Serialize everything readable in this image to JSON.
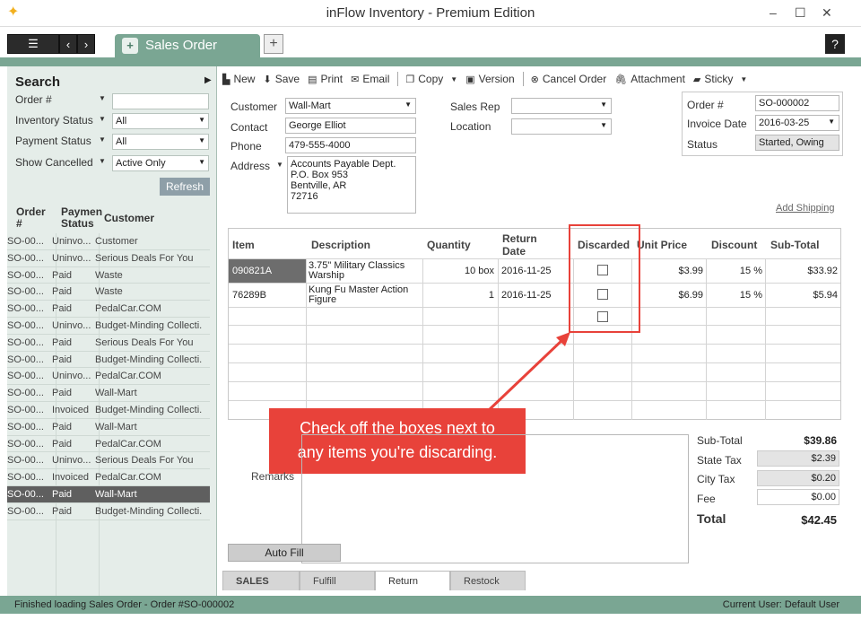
{
  "window": {
    "title": "inFlow Inventory - Premium Edition",
    "minimize": "–",
    "maximize": "☐",
    "close": "✕"
  },
  "tabbar": {
    "doc_tab": "Sales Order",
    "add_tab": "+",
    "help": "?",
    "menu_icon": "hamburger-icon",
    "back": "‹",
    "forward": "›"
  },
  "search": {
    "title": "Search",
    "fields": [
      {
        "label": "Order #",
        "value": ""
      },
      {
        "label": "Inventory Status",
        "value": "All"
      },
      {
        "label": "Payment Status",
        "value": "All"
      },
      {
        "label": "Show Cancelled",
        "value": "Active Only"
      }
    ],
    "refresh": "Refresh"
  },
  "list": {
    "headers": [
      "Order #",
      "Payment Status",
      "Customer"
    ],
    "header_order_1": "Order",
    "header_order_2": "#",
    "header_pay_1": "Paymen",
    "header_pay_2": "Status",
    "rows": [
      [
        "SO-00...",
        "Uninvo...",
        "Customer"
      ],
      [
        "SO-00...",
        "Uninvo...",
        "Serious Deals For You"
      ],
      [
        "SO-00...",
        "Paid",
        "Waste"
      ],
      [
        "SO-00...",
        "Paid",
        "Waste"
      ],
      [
        "SO-00...",
        "Paid",
        "PedalCar.COM"
      ],
      [
        "SO-00...",
        "Uninvo...",
        "Budget-Minding Collecti..."
      ],
      [
        "SO-00...",
        "Paid",
        "Serious Deals For You"
      ],
      [
        "SO-00...",
        "Paid",
        "Budget-Minding Collecti..."
      ],
      [
        "SO-00...",
        "Uninvo...",
        "PedalCar.COM"
      ],
      [
        "SO-00...",
        "Paid",
        "Wall-Mart"
      ],
      [
        "SO-00...",
        "Invoiced",
        "Budget-Minding Collecti..."
      ],
      [
        "SO-00...",
        "Paid",
        "Wall-Mart"
      ],
      [
        "SO-00...",
        "Paid",
        "PedalCar.COM"
      ],
      [
        "SO-00...",
        "Uninvo...",
        "Serious Deals For You"
      ],
      [
        "SO-00...",
        "Invoiced",
        "PedalCar.COM"
      ],
      [
        "SO-00...",
        "Paid",
        "Wall-Mart"
      ],
      [
        "SO-00...",
        "Paid",
        "Budget-Minding Collecti..."
      ]
    ],
    "selected_row": 15
  },
  "toolbar": {
    "new": "New",
    "save": "Save",
    "print": "Print",
    "email": "Email",
    "copy": "Copy",
    "version": "Version",
    "cancel_order": "Cancel Order",
    "attachment": "Attachment",
    "sticky": "Sticky"
  },
  "header": {
    "customer_label": "Customer",
    "customer": "Wall-Mart",
    "contact_label": "Contact",
    "contact": "George Elliot",
    "phone_label": "Phone",
    "phone": "479-555-4000",
    "address_label": "Address",
    "address_lines": [
      "Accounts Payable Dept.",
      "P.O. Box 953",
      "Bentville, AR",
      "72716"
    ],
    "sales_rep_label": "Sales Rep",
    "sales_rep": "",
    "location_label": "Location",
    "location": "",
    "order_no_label": "Order #",
    "order_no": "SO-000002",
    "invoice_date_label": "Invoice Date",
    "invoice_date": "2016-03-25",
    "status_label": "Status",
    "status": "Started, Owing",
    "add_shipping": "Add Shipping"
  },
  "grid": {
    "headers": [
      "Item",
      "Description",
      "Quantity",
      "Return Date",
      "Discarded",
      "Unit Price",
      "Discount",
      "Sub-Total"
    ],
    "return_date_1": "Return",
    "return_date_2": "Date",
    "rows": [
      {
        "item": "090821A",
        "desc1": "3.75\" Military Classics",
        "desc2": "Warship",
        "qty": "10 box",
        "return_date": "2016-11-25",
        "discarded": false,
        "unit_price": "$3.99",
        "discount": "15 %",
        "subtotal": "$33.92"
      },
      {
        "item": "76289B",
        "desc1": "Kung Fu Master Action",
        "desc2": "Figure",
        "qty": "1",
        "return_date": "2016-11-25",
        "discarded": false,
        "unit_price": "$6.99",
        "discount": "15 %",
        "subtotal": "$5.94"
      }
    ]
  },
  "callout": {
    "line1": "Check off the boxes next to",
    "line2": "any items you're discarding."
  },
  "remarks_label": "Remarks",
  "totals": {
    "subtotal_label": "Sub-Total",
    "subtotal": "$39.86",
    "state_tax_label": "State Tax",
    "state_tax": "$2.39",
    "city_tax_label": "City Tax",
    "city_tax": "$0.20",
    "fee_label": "Fee",
    "fee": "$0.00",
    "total_label": "Total",
    "total": "$42.45"
  },
  "autofill": "Auto Fill",
  "bottom_tabs": [
    "SALES",
    "Fulfill",
    "Return",
    "Restock"
  ],
  "statusbar": {
    "left": "Finished loading Sales Order - Order #SO-000002",
    "right": "Current User:  Default User"
  },
  "colors": {
    "accent": "#7aa693",
    "callout": "#e8423a",
    "selected_row": "#5f5f5f"
  }
}
